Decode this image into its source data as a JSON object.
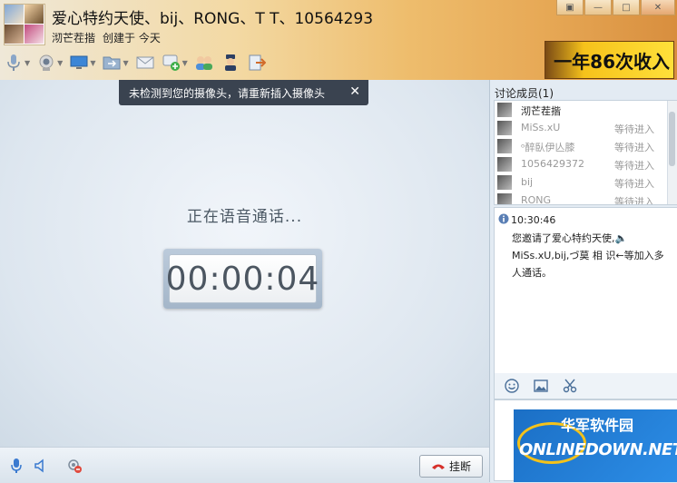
{
  "header": {
    "title": "爱心特约天使、bij、RONG、T T、10564293",
    "creator_name": "沏芒茬揩",
    "created_label": "创建于 今天"
  },
  "window_controls": [
    "▣",
    "—",
    "□",
    "✕"
  ],
  "toolbar": {
    "icons": [
      "microphone-icon",
      "camera-icon",
      "screen-share-icon",
      "folder-transfer-icon",
      "mail-icon",
      "add-chat-icon",
      "contacts-icon",
      "police-icon",
      "exit-icon"
    ]
  },
  "ad": {
    "text": "一年86次收入"
  },
  "notice": {
    "text": "未检测到您的摄像头，请重新插入摄像头",
    "close": "✕"
  },
  "call": {
    "status": "正在语音通话...",
    "timer": "00:00:04"
  },
  "bottom": {
    "hangup_label": "挂断"
  },
  "members": {
    "header": "讨论成员(1)",
    "items": [
      {
        "name": "沏芒茬揩",
        "status": ""
      },
      {
        "name": "MiSs.xU",
        "status": "等待进入"
      },
      {
        "name": "ᵒ醉臥伊亾膝",
        "status": "等待进入"
      },
      {
        "name": "1056429372",
        "status": "等待进入"
      },
      {
        "name": "bij",
        "status": "等待进入"
      },
      {
        "name": "RONG",
        "status": "等待进入"
      }
    ]
  },
  "chat": {
    "time": "10:30:46",
    "message": "您邀请了爱心特约天使,🔈MiSs.xU,bij,づ莫 相 识←等加入多人通话。"
  },
  "watermark": {
    "cn": "华军软件园",
    "en": "ONLINEDOWN.NET"
  },
  "colors": {
    "header_accent": "#eebd6d",
    "notice_bg": "#3a4350",
    "hangup_red": "#d6302a"
  }
}
